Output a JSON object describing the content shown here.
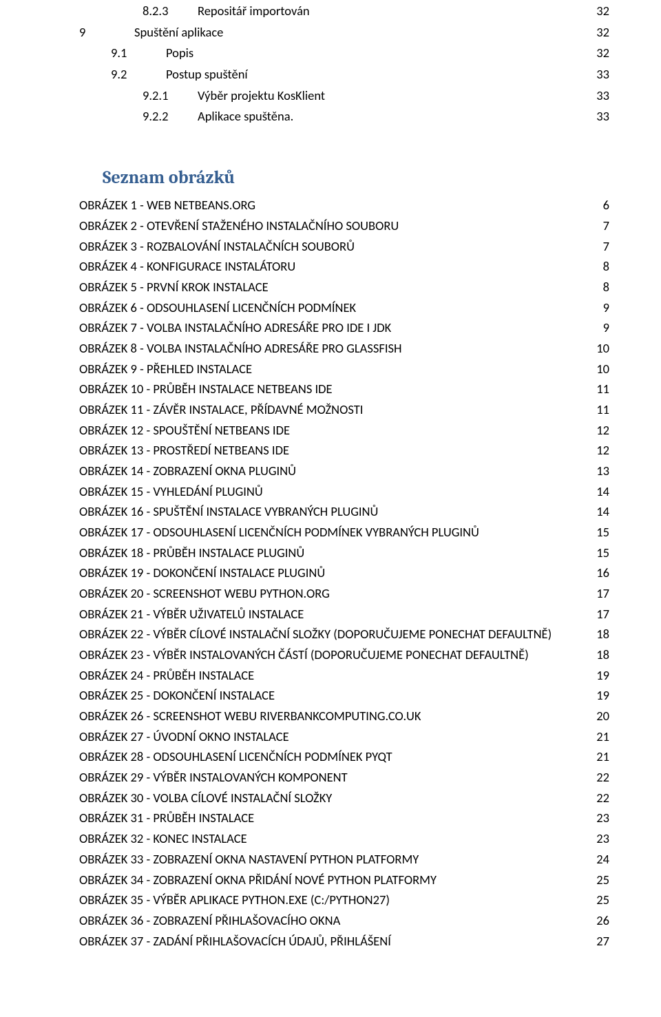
{
  "toc": [
    {
      "level": 2,
      "num": "8.2.3",
      "text": "Repositář importován",
      "page": 32
    },
    {
      "level": 0,
      "num": "9",
      "text": "Spuštění aplikace",
      "page": 32
    },
    {
      "level": 1,
      "num": "9.1",
      "text": "Popis",
      "page": 32
    },
    {
      "level": 1,
      "num": "9.2",
      "text": "Postup spuštění",
      "page": 33
    },
    {
      "level": 2,
      "num": "9.2.1",
      "text": "Výběr projektu KosKlient",
      "page": 33
    },
    {
      "level": 2,
      "num": "9.2.2",
      "text": "Aplikace spuštěna.",
      "page": 33
    }
  ],
  "figures_heading": "Seznam obrázků",
  "figures": [
    {
      "text": "OBRÁZEK 1 - WEB NETBEANS.ORG",
      "page": 6
    },
    {
      "text": "OBRÁZEK 2 - OTEVŘENÍ STAŽENÉHO INSTALAČNÍHO SOUBORU",
      "page": 7
    },
    {
      "text": "OBRÁZEK 3 - ROZBALOVÁNÍ INSTALAČNÍCH SOUBORŮ",
      "page": 7
    },
    {
      "text": "OBRÁZEK 4 - KONFIGURACE INSTALÁTORU",
      "page": 8
    },
    {
      "text": "OBRÁZEK 5 - PRVNÍ KROK INSTALACE",
      "page": 8
    },
    {
      "text": "OBRÁZEK 6 - ODSOUHLASENÍ LICENČNÍCH PODMÍNEK",
      "page": 9
    },
    {
      "text": "OBRÁZEK 7 - VOLBA INSTALAČNÍHO ADRESÁŘE PRO IDE I JDK",
      "page": 9
    },
    {
      "text": "OBRÁZEK 8 - VOLBA INSTALAČNÍHO ADRESÁŘE PRO GLASSFISH",
      "page": 10
    },
    {
      "text": "OBRÁZEK 9 - PŘEHLED INSTALACE",
      "page": 10
    },
    {
      "text": "OBRÁZEK 10 - PRŮBĚH INSTALACE NETBEANS IDE",
      "page": 11
    },
    {
      "text": "OBRÁZEK 11 - ZÁVĚR INSTALACE, PŘÍDAVNÉ MOŽNOSTI",
      "page": 11
    },
    {
      "text": "OBRÁZEK 12 - SPOUŠTĚNÍ NETBEANS IDE",
      "page": 12
    },
    {
      "text": "OBRÁZEK 13 - PROSTŘEDÍ NETBEANS IDE",
      "page": 12
    },
    {
      "text": "OBRÁZEK 14 - ZOBRAZENÍ OKNA PLUGINŮ",
      "page": 13
    },
    {
      "text": "OBRÁZEK 15 - VYHLEDÁNÍ PLUGINŮ",
      "page": 14
    },
    {
      "text": "OBRÁZEK 16 - SPUŠTĚNÍ INSTALACE VYBRANÝCH PLUGINŮ",
      "page": 14
    },
    {
      "text": "OBRÁZEK 17 - ODSOUHLASENÍ LICENČNÍCH PODMÍNEK VYBRANÝCH PLUGINŮ",
      "page": 15
    },
    {
      "text": "OBRÁZEK 18 - PRŮBĚH INSTALACE PLUGINŮ",
      "page": 15
    },
    {
      "text": "OBRÁZEK 19 - DOKONČENÍ INSTALACE PLUGINŮ",
      "page": 16
    },
    {
      "text": "OBRÁZEK 20 - SCREENSHOT WEBU PYTHON.ORG",
      "page": 17
    },
    {
      "text": "OBRÁZEK 21 - VÝBĚR UŽIVATELŮ INSTALACE",
      "page": 17
    },
    {
      "text": "OBRÁZEK 22 - VÝBĚR CÍLOVÉ INSTALAČNÍ SLOŽKY (DOPORUČUJEME PONECHAT DEFAULTNĚ)",
      "page": 18
    },
    {
      "text": "OBRÁZEK 23 - VÝBĚR INSTALOVANÝCH ČÁSTÍ (DOPORUČUJEME PONECHAT DEFAULTNĚ)",
      "page": 18
    },
    {
      "text": "OBRÁZEK 24 - PRŮBĚH INSTALACE",
      "page": 19
    },
    {
      "text": "OBRÁZEK 25 - DOKONČENÍ INSTALACE",
      "page": 19
    },
    {
      "text": "OBRÁZEK 26 - SCREENSHOT WEBU RIVERBANKCOMPUTING.CO.UK",
      "page": 20
    },
    {
      "text": "OBRÁZEK 27 - ÚVODNÍ OKNO INSTALACE",
      "page": 21
    },
    {
      "text": "OBRÁZEK 28 - ODSOUHLASENÍ LICENČNÍCH PODMÍNEK PYQT",
      "page": 21
    },
    {
      "text": "OBRÁZEK 29 - VÝBĚR INSTALOVANÝCH KOMPONENT",
      "page": 22
    },
    {
      "text": "OBRÁZEK 30 - VOLBA CÍLOVÉ INSTALAČNÍ SLOŽKY",
      "page": 22
    },
    {
      "text": "OBRÁZEK 31 - PRŮBĚH INSTALACE",
      "page": 23
    },
    {
      "text": "OBRÁZEK 32 - KONEC INSTALACE",
      "page": 23
    },
    {
      "text": "OBRÁZEK 33 - ZOBRAZENÍ OKNA NASTAVENÍ PYTHON PLATFORMY",
      "page": 24
    },
    {
      "text": "OBRÁZEK 34 - ZOBRAZENÍ OKNA PŘIDÁNÍ NOVÉ PYTHON PLATFORMY",
      "page": 25
    },
    {
      "text": "OBRÁZEK 35 - VÝBĚR APLIKACE PYTHON.EXE (C:/PYTHON27)",
      "page": 25
    },
    {
      "text": "OBRÁZEK 36 - ZOBRAZENÍ PŘIHLAŠOVACÍHO OKNA",
      "page": 26
    },
    {
      "text": "OBRÁZEK 37 - ZADÁNÍ PŘIHLAŠOVACÍCH ÚDAJŮ, PŘIHLÁŠENÍ",
      "page": 27
    }
  ]
}
